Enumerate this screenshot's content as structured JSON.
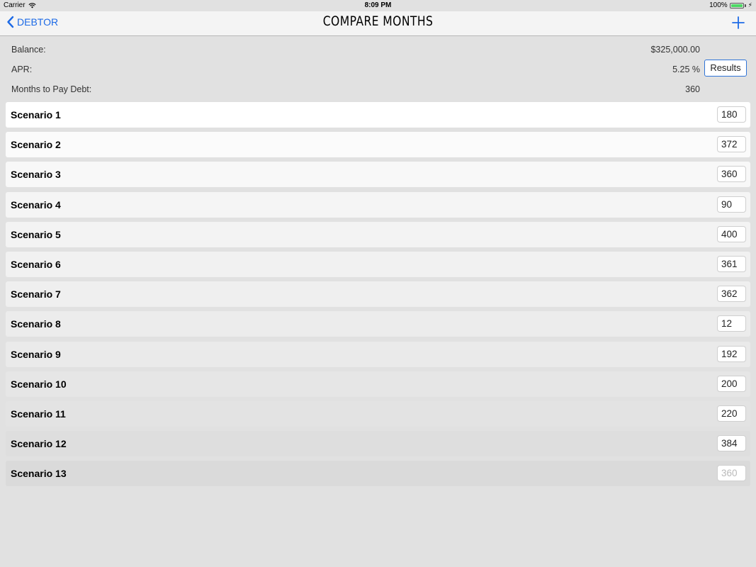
{
  "status_bar": {
    "carrier": "Carrier",
    "time": "8:09 PM",
    "battery": "100%"
  },
  "nav": {
    "back_label": "DEBTOR",
    "title": "COMPARE MONTHS",
    "add_icon": "plus-icon"
  },
  "info": {
    "balance_label": "Balance:",
    "balance_value": "$325,000.00",
    "apr_label": "APR:",
    "apr_value": "5.25 %",
    "months_label": "Months to Pay Debt:",
    "months_value": "360",
    "results_label": "Results"
  },
  "scenarios": [
    {
      "label": "Scenario 1",
      "value": "180",
      "bg": "#ffffff"
    },
    {
      "label": "Scenario 2",
      "value": "372",
      "bg": "#fbfbfb"
    },
    {
      "label": "Scenario 3",
      "value": "360",
      "bg": "#f8f8f8"
    },
    {
      "label": "Scenario 4",
      "value": "90",
      "bg": "#f5f5f5"
    },
    {
      "label": "Scenario 5",
      "value": "400",
      "bg": "#f3f3f3"
    },
    {
      "label": "Scenario 6",
      "value": "361",
      "bg": "#f1f1f1"
    },
    {
      "label": "Scenario 7",
      "value": "362",
      "bg": "#efefef"
    },
    {
      "label": "Scenario 8",
      "value": "12",
      "bg": "#ececec"
    },
    {
      "label": "Scenario 9",
      "value": "192",
      "bg": "#eaeaea"
    },
    {
      "label": "Scenario 10",
      "value": "200",
      "bg": "#e6e6e6"
    },
    {
      "label": "Scenario 11",
      "value": "220",
      "bg": "#e3e3e3"
    },
    {
      "label": "Scenario 12",
      "value": "384",
      "bg": "#dedede"
    },
    {
      "label": "Scenario 13",
      "value": "360",
      "bg": "#dadada",
      "placeholder": true
    }
  ]
}
